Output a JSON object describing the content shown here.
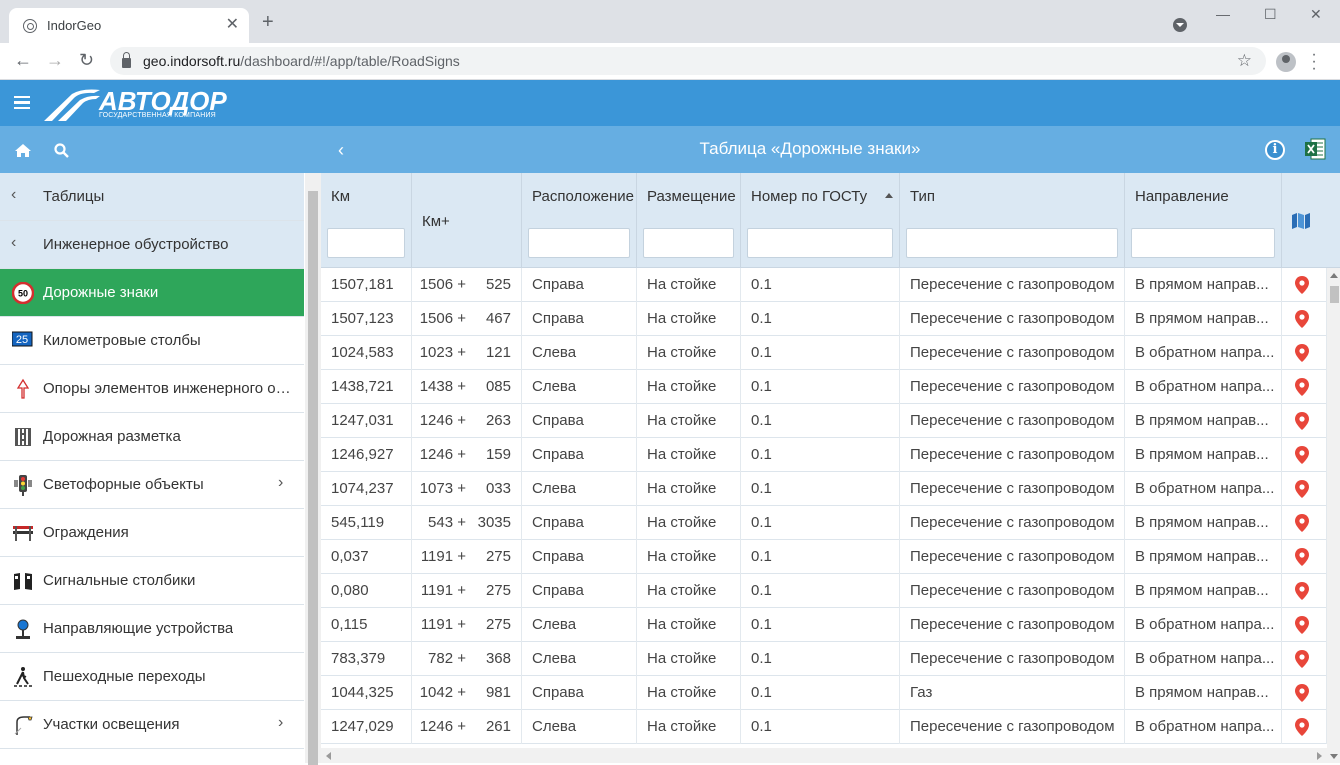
{
  "browser": {
    "tab_title": "IndorGeo",
    "tab_close": "✕",
    "new_tab": "+",
    "url_host": "geo.indorsoft.ru",
    "url_path": "/dashboard/#!/app/table/RoadSigns",
    "win_minimize": "—",
    "win_restore": "☐",
    "win_close": "✕"
  },
  "app": {
    "logo_text": "АВТОДОР",
    "logo_sub": "ГОСУДАРСТВЕННАЯ КОМПАНИЯ",
    "page_title": "Таблица «Дорожные знаки»",
    "info_label": "i"
  },
  "sidebar": {
    "items": [
      {
        "label": "Таблицы",
        "icon": "chevron-left-icon",
        "kind": "header"
      },
      {
        "label": "Инженерное обустройство",
        "icon": "chevron-left-icon",
        "kind": "header"
      },
      {
        "label": "Дорожные знаки",
        "icon": "speed-limit-sign-icon",
        "badge": "50",
        "kind": "active"
      },
      {
        "label": "Километровые столбы",
        "icon": "kilometer-post-icon",
        "badge": "25",
        "kind": "item"
      },
      {
        "label": "Опоры элементов инженерного об...",
        "icon": "support-pole-icon",
        "kind": "item"
      },
      {
        "label": "Дорожная разметка",
        "icon": "road-marking-icon",
        "kind": "item"
      },
      {
        "label": "Светофорные объекты",
        "icon": "traffic-light-icon",
        "kind": "item",
        "expandable": true
      },
      {
        "label": "Ограждения",
        "icon": "barrier-icon",
        "kind": "item"
      },
      {
        "label": "Сигнальные столбики",
        "icon": "signal-post-icon",
        "kind": "item"
      },
      {
        "label": "Направляющие устройства",
        "icon": "guide-device-icon",
        "kind": "item"
      },
      {
        "label": "Пешеходные переходы",
        "icon": "pedestrian-crossing-icon",
        "kind": "item"
      },
      {
        "label": "Участки освещения",
        "icon": "lighting-icon",
        "kind": "item",
        "expandable": true
      }
    ]
  },
  "table": {
    "columns": [
      "Км",
      "Км+",
      "Расположение",
      "Размещение",
      "Номер по ГОСТу",
      "Тип",
      "Направление"
    ],
    "sorted_column": "Номер по ГОСТу",
    "rows": [
      {
        "km": "1507,181",
        "kmp_a": "1506 +",
        "kmp_b": "525",
        "loc": "Справа",
        "place": "На стойке",
        "gost": "0.1",
        "type": "Пересечение с газопроводом",
        "dir": "В прямом направ..."
      },
      {
        "km": "1507,123",
        "kmp_a": "1506 +",
        "kmp_b": "467",
        "loc": "Справа",
        "place": "На стойке",
        "gost": "0.1",
        "type": "Пересечение с газопроводом",
        "dir": "В прямом направ..."
      },
      {
        "km": "1024,583",
        "kmp_a": "1023 +",
        "kmp_b": "121",
        "loc": "Слева",
        "place": "На стойке",
        "gost": "0.1",
        "type": "Пересечение с газопроводом",
        "dir": "В обратном напра..."
      },
      {
        "km": "1438,721",
        "kmp_a": "1438 +",
        "kmp_b": "085",
        "loc": "Слева",
        "place": "На стойке",
        "gost": "0.1",
        "type": "Пересечение с газопроводом",
        "dir": "В обратном напра..."
      },
      {
        "km": "1247,031",
        "kmp_a": "1246 +",
        "kmp_b": "263",
        "loc": "Справа",
        "place": "На стойке",
        "gost": "0.1",
        "type": "Пересечение с газопроводом",
        "dir": "В прямом направ..."
      },
      {
        "km": "1246,927",
        "kmp_a": "1246 +",
        "kmp_b": "159",
        "loc": "Справа",
        "place": "На стойке",
        "gost": "0.1",
        "type": "Пересечение с газопроводом",
        "dir": "В прямом направ..."
      },
      {
        "km": "1074,237",
        "kmp_a": "1073 +",
        "kmp_b": "033",
        "loc": "Слева",
        "place": "На стойке",
        "gost": "0.1",
        "type": "Пересечение с газопроводом",
        "dir": "В обратном напра..."
      },
      {
        "km": "545,119",
        "kmp_a": "543 +",
        "kmp_b": "3035",
        "loc": "Справа",
        "place": "На стойке",
        "gost": "0.1",
        "type": "Пересечение с газопроводом",
        "dir": "В прямом направ..."
      },
      {
        "km": "0,037",
        "kmp_a": "1191 +",
        "kmp_b": "275",
        "loc": "Справа",
        "place": "На стойке",
        "gost": "0.1",
        "type": "Пересечение с газопроводом",
        "dir": "В прямом направ..."
      },
      {
        "km": "0,080",
        "kmp_a": "1191 +",
        "kmp_b": "275",
        "loc": "Справа",
        "place": "На стойке",
        "gost": "0.1",
        "type": "Пересечение с газопроводом",
        "dir": "В прямом направ..."
      },
      {
        "km": "0,115",
        "kmp_a": "1191 +",
        "kmp_b": "275",
        "loc": "Слева",
        "place": "На стойке",
        "gost": "0.1",
        "type": "Пересечение с газопроводом",
        "dir": "В обратном напра..."
      },
      {
        "km": "783,379",
        "kmp_a": "782 +",
        "kmp_b": "368",
        "loc": "Слева",
        "place": "На стойке",
        "gost": "0.1",
        "type": "Пересечение с газопроводом",
        "dir": "В обратном напра..."
      },
      {
        "km": "1044,325",
        "kmp_a": "1042 +",
        "kmp_b": "981",
        "loc": "Справа",
        "place": "На стойке",
        "gost": "0.1",
        "type": "Газ",
        "dir": "В прямом направ..."
      },
      {
        "km": "1247,029",
        "kmp_a": "1246 +",
        "kmp_b": "261",
        "loc": "Слева",
        "place": "На стойке",
        "gost": "0.1",
        "type": "Пересечение с газопроводом",
        "dir": "В обратном напра..."
      }
    ]
  },
  "colors": {
    "app_header": "#3b96d8",
    "sub_header": "#66aee2",
    "active_item": "#2ea65a",
    "pin": "#e8463a"
  }
}
